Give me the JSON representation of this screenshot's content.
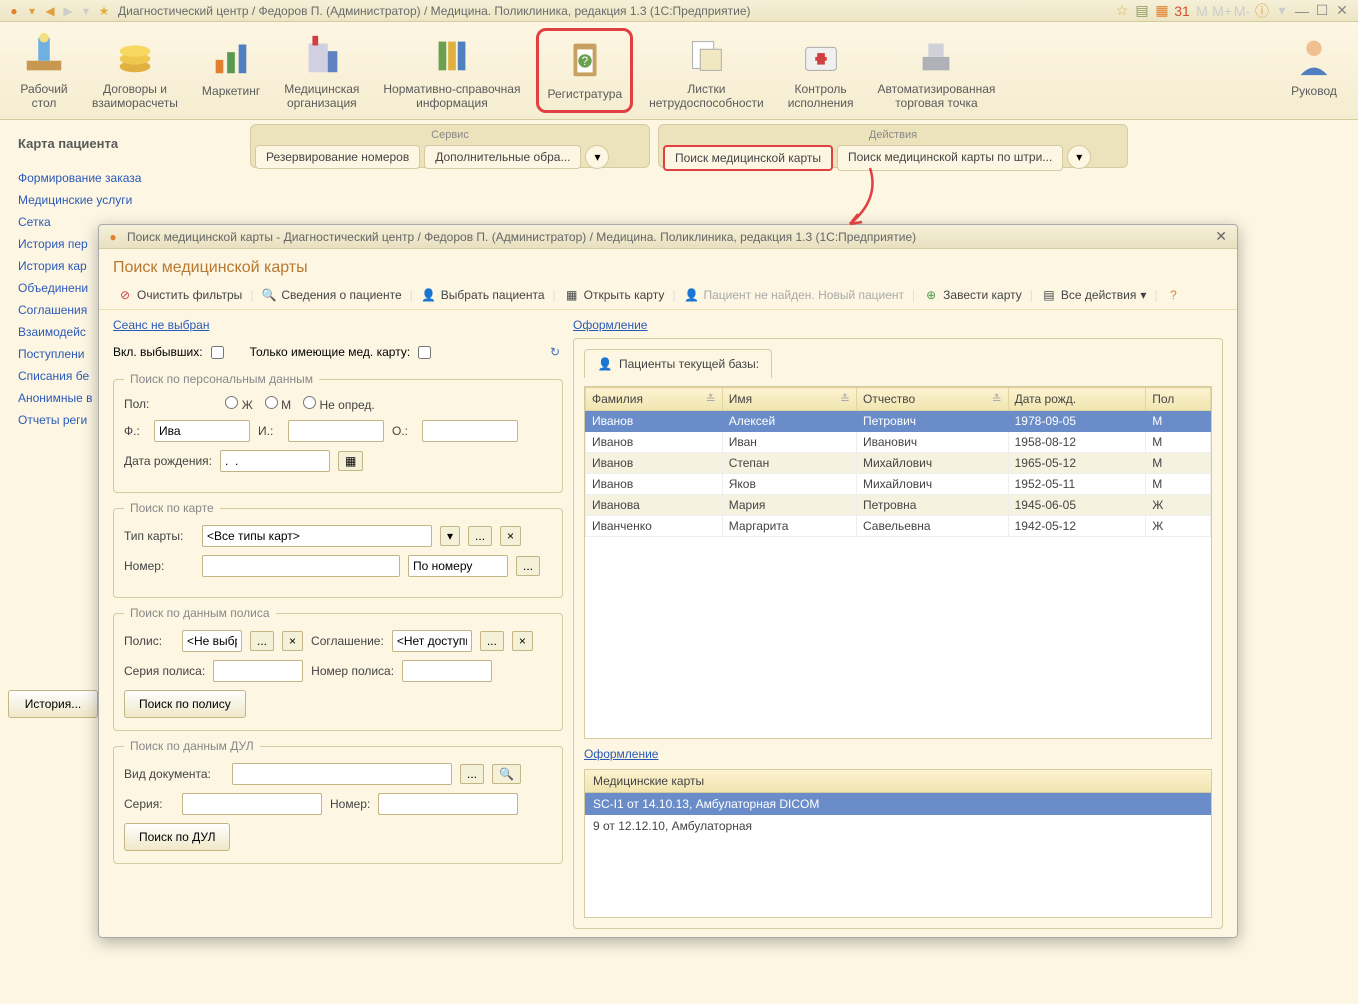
{
  "titlebar": {
    "text": "Диагностический центр / Федоров П. (Администратор) / Медицина. Поликлиника, редакция 1.3  (1С:Предприятие)"
  },
  "toolbar": {
    "items": [
      {
        "label": "Рабочий\nстол"
      },
      {
        "label": "Договоры и\nвзаиморасчеты"
      },
      {
        "label": "Маркетинг"
      },
      {
        "label": "Медицинская\nорганизация"
      },
      {
        "label": "Нормативно-справочная\nинформация"
      },
      {
        "label": "Регистратура"
      },
      {
        "label": "Листки\nнетрудоспособности"
      },
      {
        "label": "Контроль\nисполнения"
      },
      {
        "label": "Автоматизированная\nторговая точка"
      },
      {
        "label": "Руковод"
      }
    ]
  },
  "svc": {
    "service_title": "Сервис",
    "actions_title": "Действия",
    "reserve": "Резервирование номеров",
    "additional": "Дополнительные обра...",
    "search_card": "Поиск медицинской карты",
    "search_barcode": "Поиск медицинской карты по штри..."
  },
  "sidebar": {
    "title": "Карта пациента",
    "items": [
      "Формирование заказа",
      "Медицинские услуги",
      "Сетка",
      "История пер",
      "История кар",
      "Объединени",
      "Соглашения",
      "Взаимодейс",
      "Поступлени",
      "Списания бе",
      "Анонимные в",
      "Отчеты реги"
    ]
  },
  "history_btn": "История...",
  "modal": {
    "title": "Поиск медицинской карты - Диагностический центр / Федоров П. (Администратор) / Медицина. Поликлиника, редакция 1.3  (1С:Предприятие)",
    "heading": "Поиск медицинской карты",
    "toolbar": {
      "clear": "Очистить фильтры",
      "info": "Сведения о пациенте",
      "choose": "Выбрать пациента",
      "open": "Открыть карту",
      "notfound": "Пациент не найден. Новый пациент",
      "create": "Завести карту",
      "all": "Все действия"
    },
    "seance": "Сеанс не выбран",
    "design": "Оформление",
    "incl_left": "Вкл. выбывших:",
    "only_card": "Только имеющие мед. карту:",
    "personal": {
      "legend": "Поиск по персональным данным",
      "sex_label": "Пол:",
      "sex_f": "Ж",
      "sex_m": "М",
      "sex_n": "Не опред.",
      "f_label": "Ф.:",
      "f_value": "Ива",
      "i_label": "И.:",
      "o_label": "О.:",
      "dob_label": "Дата рождения:",
      "dob_value": ".  ."
    },
    "bycard": {
      "legend": "Поиск по  карте",
      "type_label": "Тип карты:",
      "type_value": "<Все типы карт>",
      "num_label": "Номер:",
      "mode": "По номеру"
    },
    "bypolis": {
      "legend": "Поиск по данным полиса",
      "polis_label": "Полис:",
      "polis_value": "<Не выбра",
      "agreement_label": "Соглашение:",
      "agreement_value": "<Нет доступн",
      "series_label": "Серия полиса:",
      "num_label": "Номер полиса:",
      "btn": "Поиск по полису"
    },
    "bydul": {
      "legend": "Поиск по данным ДУЛ",
      "doctype_label": "Вид документа:",
      "series_label": "Серия:",
      "num_label": "Номер:",
      "btn": "Поиск по ДУЛ"
    },
    "patients_tab": "Пациенты текущей базы:",
    "cols": {
      "surname": "Фамилия",
      "name": "Имя",
      "patr": "Отчество",
      "dob": "Дата рожд.",
      "sex": "Пол"
    },
    "rows": [
      {
        "s": "Иванов",
        "n": "Алексей",
        "p": "Петрович",
        "d": "1978-09-05",
        "x": "М",
        "sel": true
      },
      {
        "s": "Иванов",
        "n": "Иван",
        "p": "Иванович",
        "d": "1958-08-12",
        "x": "М"
      },
      {
        "s": "Иванов",
        "n": "Степан",
        "p": "Михайлович",
        "d": "1965-05-12",
        "x": "М"
      },
      {
        "s": "Иванов",
        "n": "Яков",
        "p": "Михайлович",
        "d": "1952-05-11",
        "x": "М"
      },
      {
        "s": "Иванова",
        "n": "Мария",
        "p": "Петровна",
        "d": "1945-06-05",
        "x": "Ж"
      },
      {
        "s": "Иванченко",
        "n": "Маргарита",
        "p": "Савельевна",
        "d": "1942-05-12",
        "x": "Ж"
      }
    ],
    "design2": "Оформление",
    "cards_title": "Медицинские карты",
    "cards": [
      {
        "t": "SC-I1 от 14.10.13, Амбулаторная DICOM",
        "sel": true
      },
      {
        "t": "9 от 12.12.10, Амбулаторная"
      }
    ]
  }
}
